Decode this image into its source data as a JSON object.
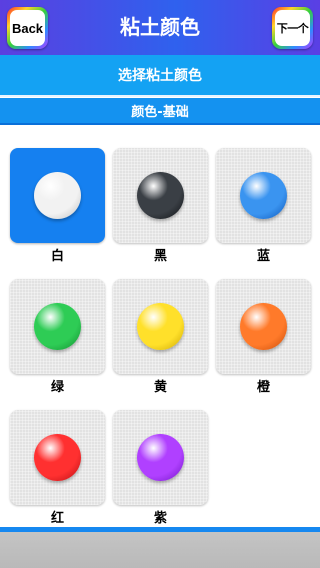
{
  "header": {
    "title": "粘土颜色",
    "back_label": "Back",
    "next_label": "下一个"
  },
  "select_bar": {
    "label": "选择粘土颜色"
  },
  "category_bar": {
    "label": "颜色-基础"
  },
  "colors": [
    {
      "label": "白",
      "ball": "#f2f2f2",
      "ball_shadow": "#bdbdbd",
      "selected": true
    },
    {
      "label": "黑",
      "ball": "#3a3f45",
      "ball_shadow": "#0d0f12",
      "selected": false
    },
    {
      "label": "蓝",
      "ball": "#3a94f0",
      "ball_shadow": "#0d55b8",
      "selected": false
    },
    {
      "label": "绿",
      "ball": "#2ecc55",
      "ball_shadow": "#118a2e",
      "selected": false
    },
    {
      "label": "黄",
      "ball": "#ffe02a",
      "ball_shadow": "#c9a400",
      "selected": false
    },
    {
      "label": "橙",
      "ball": "#ff7a2a",
      "ball_shadow": "#c74a06",
      "selected": false
    },
    {
      "label": "红",
      "ball": "#ff3030",
      "ball_shadow": "#b30c12",
      "selected": false
    },
    {
      "label": "紫",
      "ball": "#b040ff",
      "ball_shadow": "#6f14c4",
      "selected": false
    }
  ],
  "theme": {
    "header_blue": "#2f61ee",
    "select_bar": "#14a2f3",
    "category_bar": "#1492f0",
    "selected_tile": "#1580f0",
    "footer": "#c0c0c0"
  }
}
